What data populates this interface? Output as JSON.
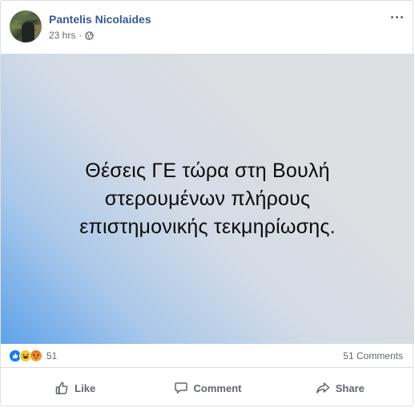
{
  "post": {
    "author": "Pantelis Nicolaides",
    "time": "23 hrs",
    "separator": "·",
    "privacy_icon": "globe-icon",
    "image_text": "Θέσεις ΓΕ τώρα στη Βουλή\nστερουμένων πλήρους\nεπιστημονικής τεκμηρίωσης.",
    "reaction_count": "51",
    "comments_count": "51 Comments",
    "reactions": [
      "like-icon",
      "haha-icon",
      "angry-icon"
    ]
  },
  "actions": {
    "like": "Like",
    "comment": "Comment",
    "share": "Share"
  },
  "colors": {
    "author": "#365899",
    "meta": "#616770",
    "action_text": "#606770",
    "like_blue": "#1877f2"
  }
}
